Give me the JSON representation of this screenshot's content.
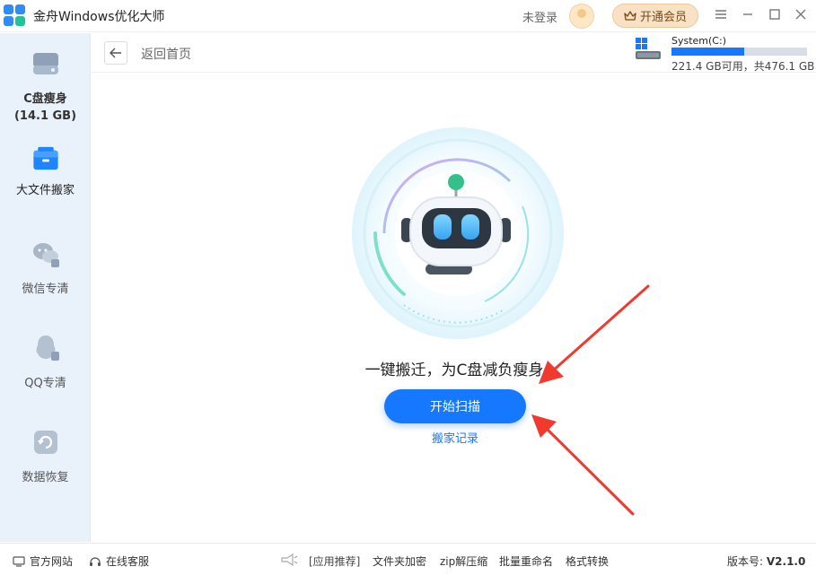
{
  "app": {
    "title": "金舟Windows优化大师",
    "login_text": "未登录",
    "vip_label": "开通会员",
    "window_controls": [
      "menu-icon",
      "minimize-icon",
      "maximize-icon",
      "close-icon"
    ]
  },
  "sidebar": {
    "items": [
      {
        "label": "C盘瘦身",
        "sub": "(14.1 GB)",
        "icon": "disk-icon",
        "active": false
      },
      {
        "label": "大文件搬家",
        "icon": "box-icon",
        "active": true
      },
      {
        "label": "微信专清",
        "icon": "wechat-icon",
        "active": false
      },
      {
        "label": "QQ专清",
        "icon": "qq-icon",
        "active": false
      },
      {
        "label": "数据恢复",
        "icon": "recover-icon",
        "active": false
      }
    ]
  },
  "subbar": {
    "back_label": "返回首页",
    "disk": {
      "name": "System(C:)",
      "info": "221.4 GB可用，共476.1 GB",
      "used_fraction": 0.535
    }
  },
  "main": {
    "headline": "一键搬迁，为C盘减负瘦身",
    "scan_button": "开始扫描",
    "record_link": "搬家记录"
  },
  "bottom": {
    "official_site": "官方网站",
    "online_service": "在线客服",
    "recommend": "[应用推荐]",
    "links": [
      "文件夹加密",
      "zip解压缩",
      "批量重命名",
      "格式转换"
    ],
    "version_label": "版本号:",
    "version_value": "V2.1.0"
  },
  "colors": {
    "accent": "#1677ff",
    "sidebar_bg": "#e9f1fb",
    "vip_bg": "#f8e1c4",
    "arrow": "#f03a2e"
  }
}
